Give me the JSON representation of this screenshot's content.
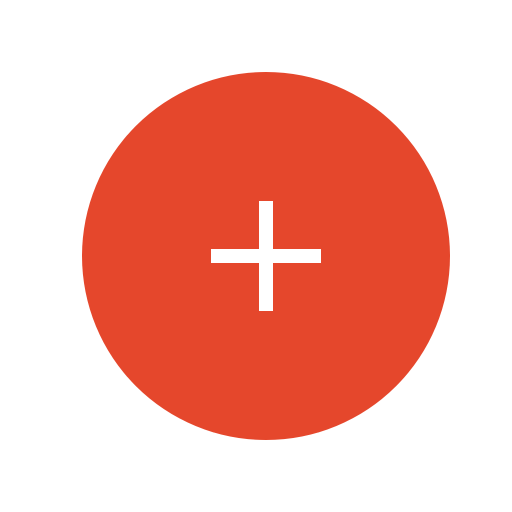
{
  "fab": {
    "icon": "plus-icon",
    "accent_color": "#e5472c",
    "icon_color": "#ffffff"
  }
}
